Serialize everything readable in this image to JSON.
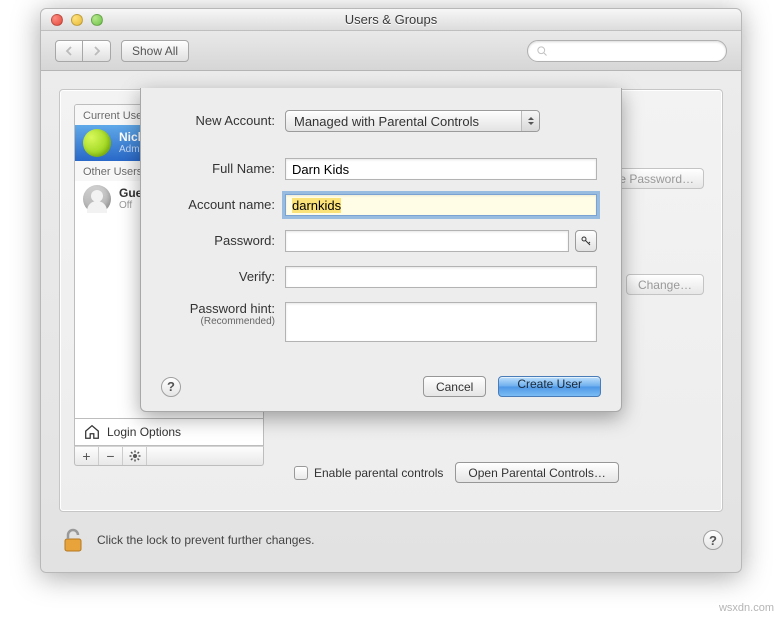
{
  "window": {
    "title": "Users & Groups"
  },
  "toolbar": {
    "show_all": "Show All",
    "search_placeholder": ""
  },
  "sidebar": {
    "current_header": "Current User",
    "other_header": "Other Users",
    "current_user": {
      "name": "Nick Me",
      "role": "Admin"
    },
    "guest": {
      "name": "Guest U",
      "status": "Off"
    },
    "login_options": "Login Options"
  },
  "main": {
    "change_password": "Change Password…",
    "change": "Change…",
    "enable_pc": "Enable parental controls",
    "open_pc": "Open Parental Controls…"
  },
  "sheet": {
    "labels": {
      "new_account": "New Account:",
      "full_name": "Full Name:",
      "account_name": "Account name:",
      "password": "Password:",
      "verify": "Verify:",
      "hint": "Password hint:",
      "hint_sub": "(Recommended)"
    },
    "values": {
      "account_type": "Managed with Parental Controls",
      "full_name": "Darn Kids",
      "account_name": "darnkids",
      "password": "",
      "verify": "",
      "hint": ""
    },
    "buttons": {
      "cancel": "Cancel",
      "create": "Create User",
      "help": "?"
    }
  },
  "footer": {
    "lock_text": "Click the lock to prevent further changes.",
    "help": "?"
  },
  "watermark": "wsxdn.com"
}
